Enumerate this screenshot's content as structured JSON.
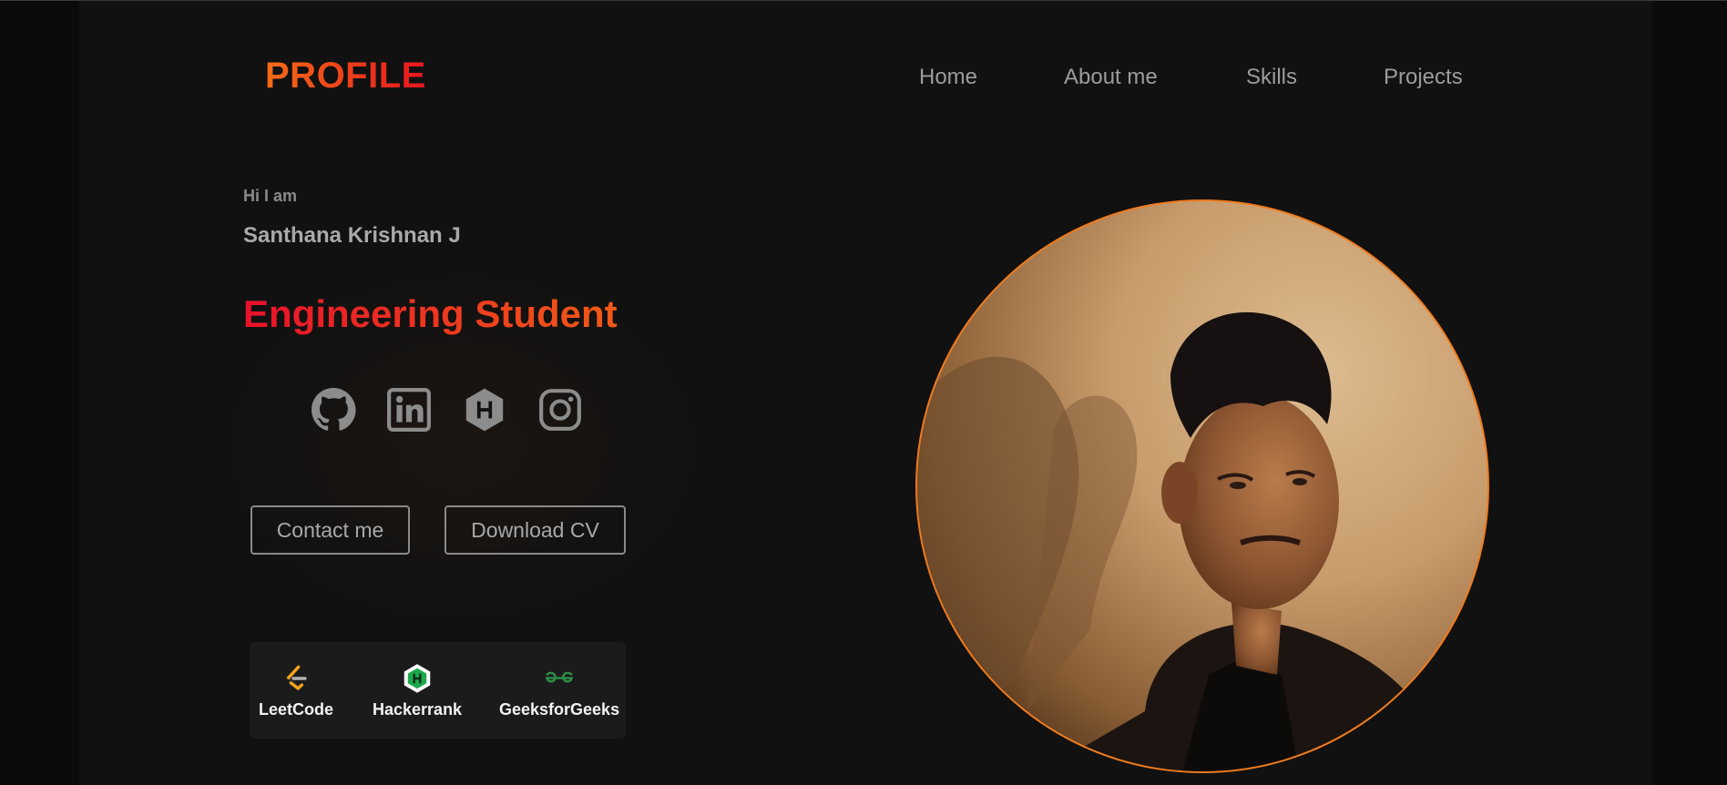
{
  "header": {
    "logo": "PROFILE",
    "nav": [
      "Home",
      "About me",
      "Skills",
      "Projects"
    ]
  },
  "hero": {
    "greeting": "Hi I am",
    "name": "Santhana Krishnan J",
    "role": "Engineering Student"
  },
  "social_icons": [
    "github-icon",
    "linkedin-icon",
    "hashnode-icon",
    "instagram-icon"
  ],
  "buttons": {
    "contact": "Contact me",
    "download": "Download CV"
  },
  "platforms": [
    {
      "label": "LeetCode",
      "icon": "leetcode-icon"
    },
    {
      "label": "Hackerrank",
      "icon": "hackerrank-icon"
    },
    {
      "label": "GeeksforGeeks",
      "icon": "geeksforgeeks-icon"
    }
  ],
  "colors": {
    "accent_orange": "#f46b16",
    "accent_red": "#e8151f",
    "background": "#111111"
  }
}
